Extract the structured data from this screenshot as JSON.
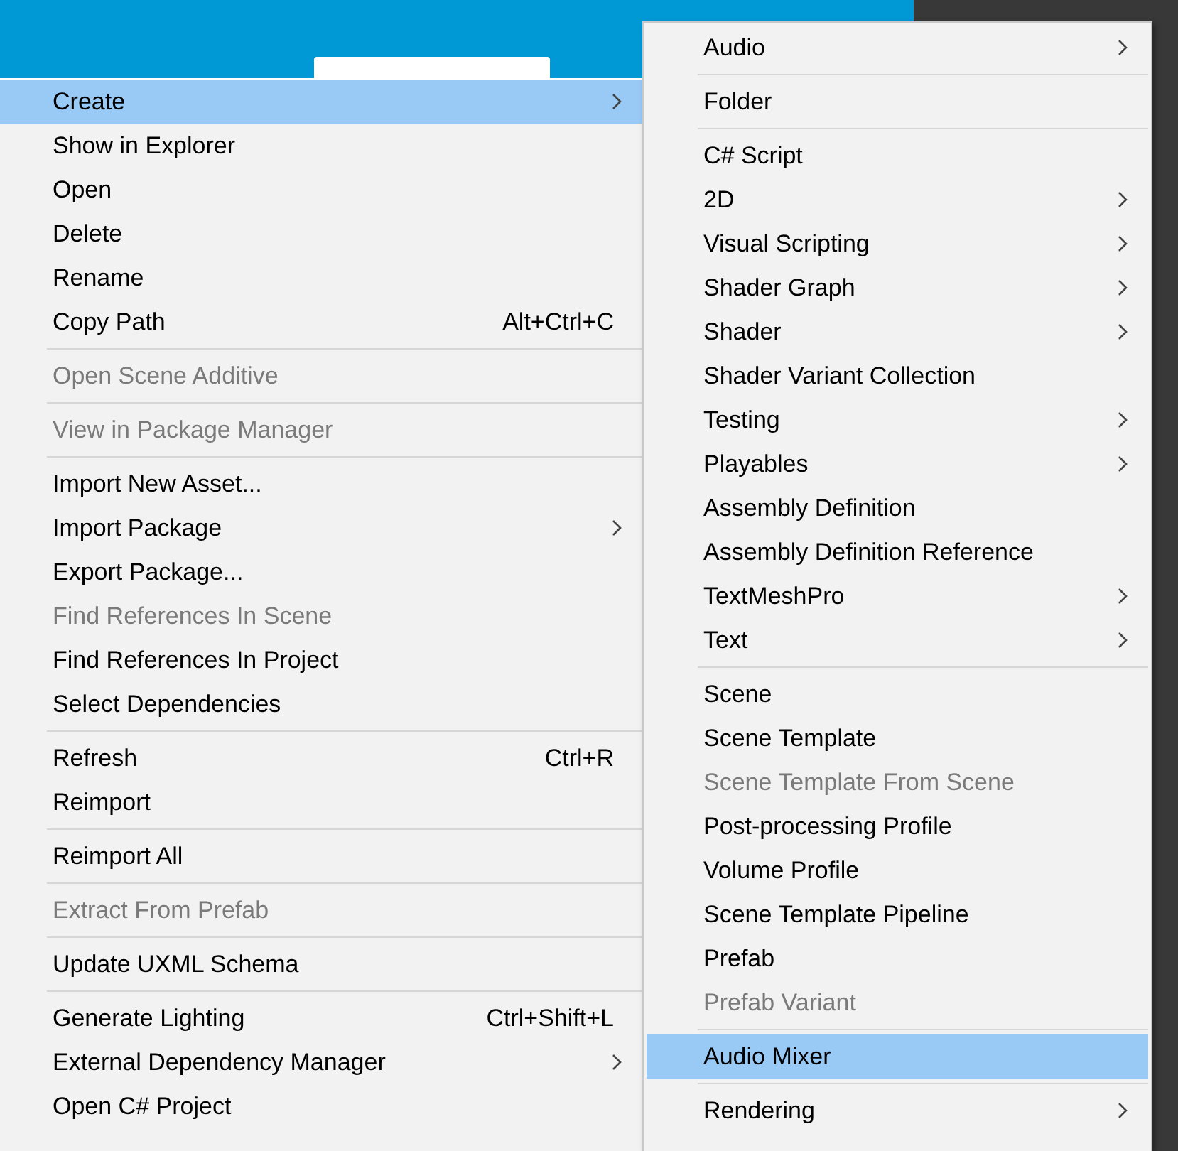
{
  "left_menu": {
    "sections": [
      [
        {
          "label": "Create",
          "submenu": true,
          "selected": true,
          "disabled": false
        },
        {
          "label": "Show in Explorer",
          "selected": false,
          "disabled": false
        },
        {
          "label": "Open",
          "selected": false,
          "disabled": false
        },
        {
          "label": "Delete",
          "selected": false,
          "disabled": false
        },
        {
          "label": "Rename",
          "selected": false,
          "disabled": false
        },
        {
          "label": "Copy Path",
          "shortcut": "Alt+Ctrl+C",
          "selected": false,
          "disabled": false
        }
      ],
      [
        {
          "label": "Open Scene Additive",
          "selected": false,
          "disabled": true
        }
      ],
      [
        {
          "label": "View in Package Manager",
          "selected": false,
          "disabled": true
        }
      ],
      [
        {
          "label": "Import New Asset...",
          "selected": false,
          "disabled": false
        },
        {
          "label": "Import Package",
          "submenu": true,
          "selected": false,
          "disabled": false
        },
        {
          "label": "Export Package...",
          "selected": false,
          "disabled": false
        },
        {
          "label": "Find References In Scene",
          "selected": false,
          "disabled": true
        },
        {
          "label": "Find References In Project",
          "selected": false,
          "disabled": false
        },
        {
          "label": "Select Dependencies",
          "selected": false,
          "disabled": false
        }
      ],
      [
        {
          "label": "Refresh",
          "shortcut": "Ctrl+R",
          "selected": false,
          "disabled": false
        },
        {
          "label": "Reimport",
          "selected": false,
          "disabled": false
        }
      ],
      [
        {
          "label": "Reimport All",
          "selected": false,
          "disabled": false
        }
      ],
      [
        {
          "label": "Extract From Prefab",
          "selected": false,
          "disabled": true
        }
      ],
      [
        {
          "label": "Update UXML Schema",
          "selected": false,
          "disabled": false
        }
      ],
      [
        {
          "label": "Generate Lighting",
          "shortcut": "Ctrl+Shift+L",
          "selected": false,
          "disabled": false
        },
        {
          "label": "External Dependency Manager",
          "submenu": true,
          "selected": false,
          "disabled": false
        },
        {
          "label": "Open C# Project",
          "selected": false,
          "disabled": false
        }
      ]
    ]
  },
  "submenu": {
    "sections": [
      [
        {
          "label": "Audio",
          "submenu": true,
          "selected": false,
          "disabled": false
        }
      ],
      [
        {
          "label": "Folder",
          "selected": false,
          "disabled": false
        }
      ],
      [
        {
          "label": "C# Script",
          "selected": false,
          "disabled": false
        },
        {
          "label": "2D",
          "submenu": true,
          "selected": false,
          "disabled": false
        },
        {
          "label": "Visual Scripting",
          "submenu": true,
          "selected": false,
          "disabled": false
        },
        {
          "label": "Shader Graph",
          "submenu": true,
          "selected": false,
          "disabled": false
        },
        {
          "label": "Shader",
          "submenu": true,
          "selected": false,
          "disabled": false
        },
        {
          "label": "Shader Variant Collection",
          "selected": false,
          "disabled": false
        },
        {
          "label": "Testing",
          "submenu": true,
          "selected": false,
          "disabled": false
        },
        {
          "label": "Playables",
          "submenu": true,
          "selected": false,
          "disabled": false
        },
        {
          "label": "Assembly Definition",
          "selected": false,
          "disabled": false
        },
        {
          "label": "Assembly Definition Reference",
          "selected": false,
          "disabled": false
        },
        {
          "label": "TextMeshPro",
          "submenu": true,
          "selected": false,
          "disabled": false
        },
        {
          "label": "Text",
          "submenu": true,
          "selected": false,
          "disabled": false
        }
      ],
      [
        {
          "label": "Scene",
          "selected": false,
          "disabled": false
        },
        {
          "label": "Scene Template",
          "selected": false,
          "disabled": false
        },
        {
          "label": "Scene Template From Scene",
          "selected": false,
          "disabled": true
        },
        {
          "label": "Post-processing Profile",
          "selected": false,
          "disabled": false
        },
        {
          "label": "Volume Profile",
          "selected": false,
          "disabled": false
        },
        {
          "label": "Scene Template Pipeline",
          "selected": false,
          "disabled": false
        },
        {
          "label": "Prefab",
          "selected": false,
          "disabled": false
        },
        {
          "label": "Prefab Variant",
          "selected": false,
          "disabled": true
        }
      ],
      [
        {
          "label": "Audio Mixer",
          "selected": true,
          "disabled": false
        }
      ],
      [
        {
          "label": "Rendering",
          "submenu": true,
          "selected": false,
          "disabled": false
        }
      ]
    ]
  }
}
